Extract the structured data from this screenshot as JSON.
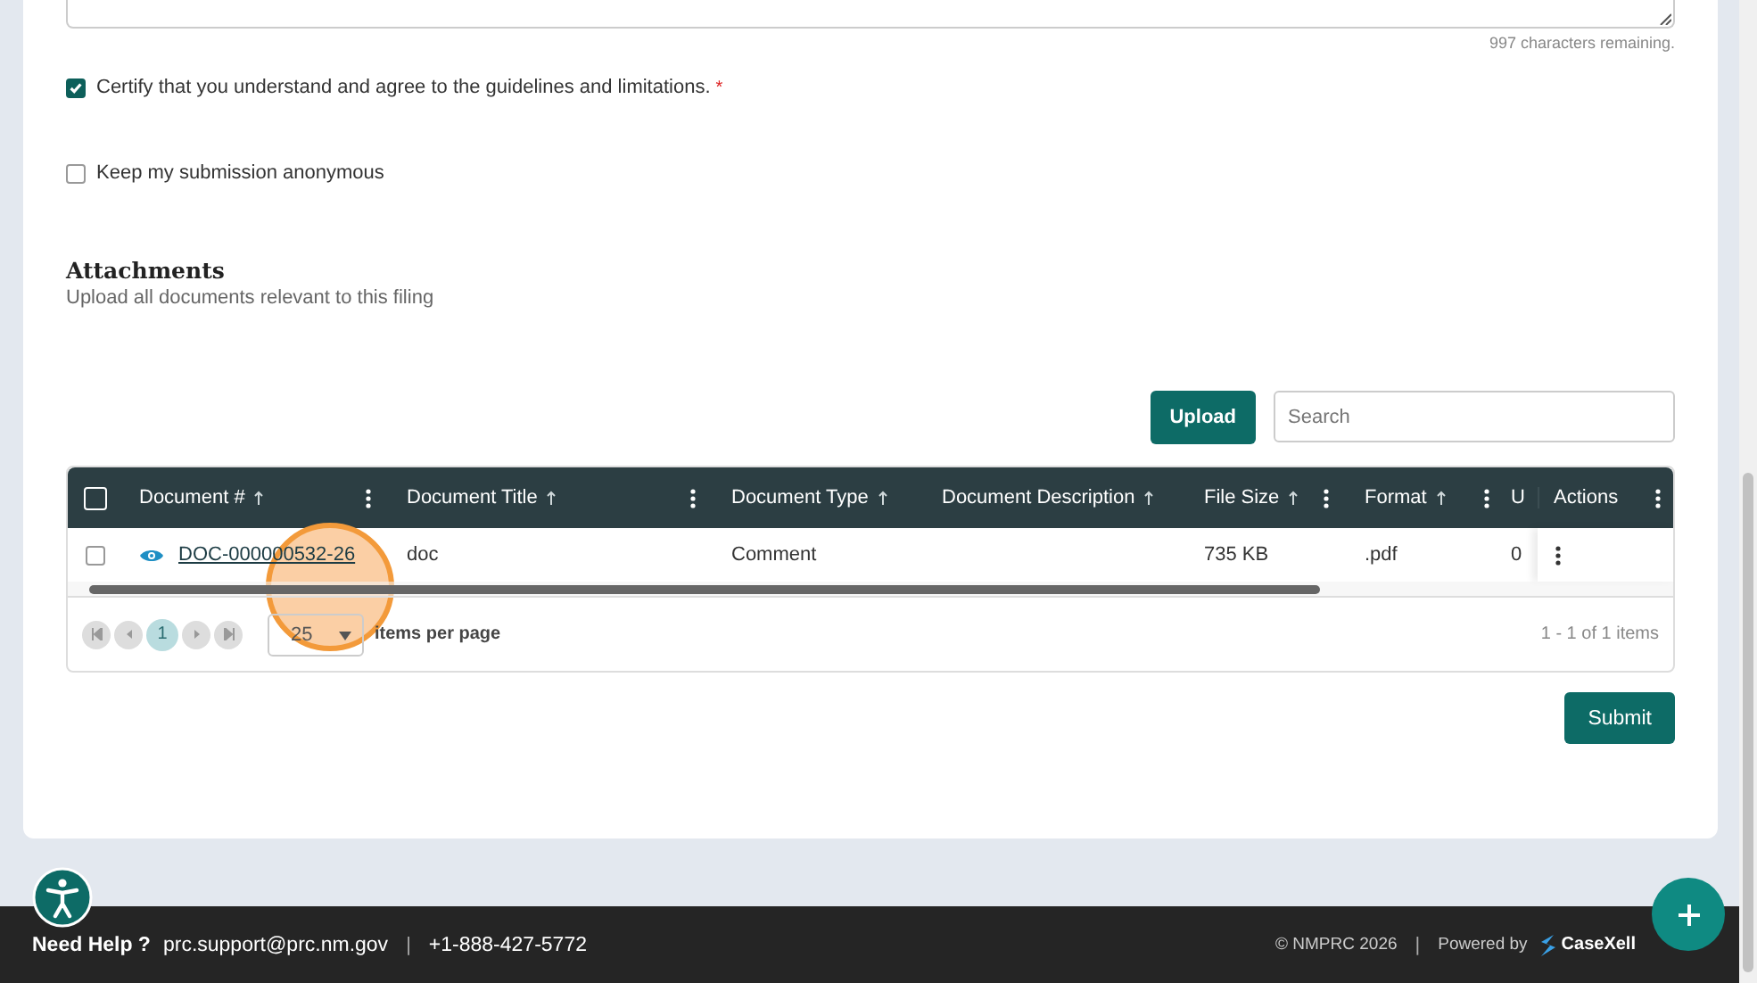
{
  "comment_box": {
    "counter": "997 characters remaining."
  },
  "options": [
    {
      "label": "Certify that you understand and agree to the guidelines and limitations.",
      "required_mark": "*",
      "checked": true
    },
    {
      "label": "Keep my submission anonymous",
      "checked": false
    }
  ],
  "attachments": {
    "title": "Attachments",
    "subtitle": "Upload all documents relevant to this filing",
    "upload_button": "Upload",
    "search": {
      "placeholder": "Search"
    },
    "table": {
      "columns": [
        {
          "label": "Document #",
          "sortable": true,
          "menu": true
        },
        {
          "label": "Document Title",
          "sortable": true,
          "menu": true
        },
        {
          "label": "Document Type",
          "sortable": true,
          "menu": false
        },
        {
          "label": "Document Description",
          "sortable": true,
          "menu": false
        },
        {
          "label": "File Size",
          "sortable": true,
          "menu": true
        },
        {
          "label": "Format",
          "sortable": true,
          "menu": true
        },
        {
          "label": "U"
        },
        {
          "label": "Actions",
          "sortable": false,
          "menu": true
        }
      ],
      "all_selected": false,
      "rows": [
        {
          "selected": false,
          "cells": [
            "DOC-000000532-26",
            "doc",
            "Comment",
            "",
            "735 KB",
            ".pdf",
            "0"
          ]
        }
      ]
    },
    "pager": {
      "pages": [
        {
          "label": "1",
          "selected": true
        }
      ],
      "page_size": "25",
      "page_size_label": "items per page",
      "summary": "1 - 1 of 1 items"
    }
  },
  "submit_button": "Submit",
  "footer": {
    "help_label": "Need Help ?",
    "email": "prc.support@prc.nm.gov",
    "phone": "+1-888-427-5772",
    "separators": [
      "|",
      "|"
    ],
    "copyright": "© NMPRC 2026",
    "powered_by": "Powered by",
    "brand": "CaseXell"
  }
}
